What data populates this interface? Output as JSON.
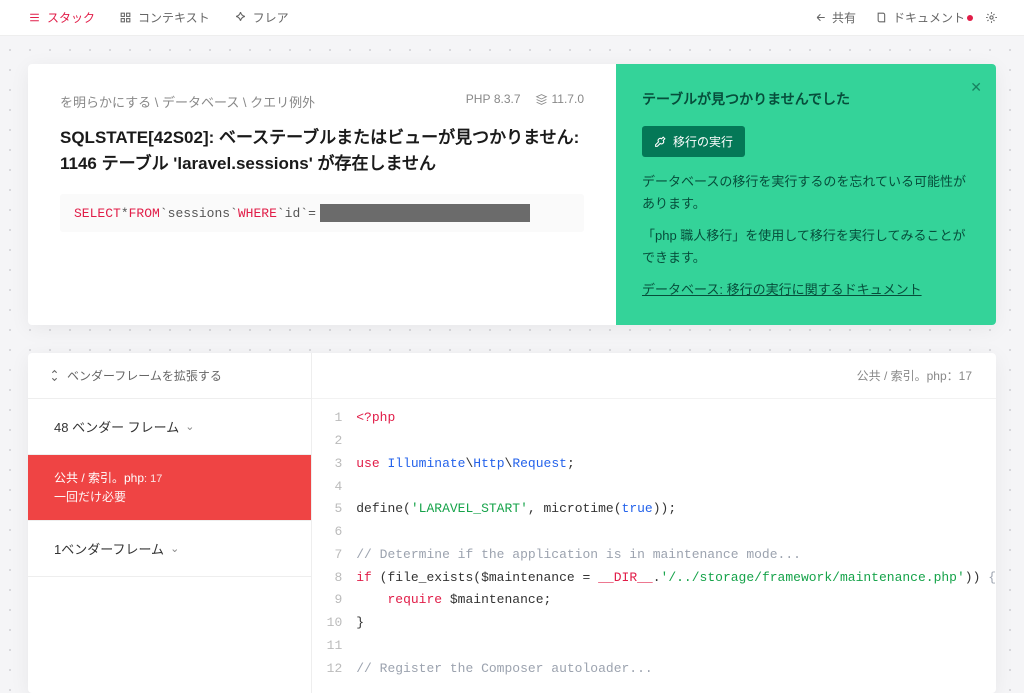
{
  "topbar": {
    "tabs": [
      {
        "label": "スタック",
        "active": true,
        "icon": "stack"
      },
      {
        "label": "コンテキスト",
        "active": false,
        "icon": "context"
      },
      {
        "label": "フレア",
        "active": false,
        "icon": "flare"
      }
    ],
    "share_label": "共有",
    "docs_label": "ドキュメント"
  },
  "error": {
    "breadcrumb": "を明らかにする \\ データベース \\ クエリ例外",
    "php_label": "PHP",
    "php_version": "8.3.7",
    "laravel_version": "11.7.0",
    "title": "SQLSTATE[42S02]: ベーステーブルまたはビューが見つかりません: 1146 テーブル 'laravel.sessions' が存在しません",
    "sql_tokens": {
      "select": "SELECT",
      "star": " * ",
      "from": "FROM",
      "table": " `sessions` ",
      "where": "WHERE",
      "col": " `id` ",
      "eq": "="
    }
  },
  "solution": {
    "title": "テーブルが見つかりませんでした",
    "run_button": "移行の実行",
    "line1": "データベースの移行を実行するのを忘れている可能性があります。",
    "line2": "「php 職人移行」を使用して移行を実行してみることができます。",
    "link": "データベース: 移行の実行に関するドキュメント"
  },
  "frames": {
    "expand_label": "ベンダーフレームを拡張する",
    "group1": "48 ベンダー フレーム",
    "active_path": "公共 / 索引。php",
    "active_line": ": 17",
    "active_desc": "一回だけ必要",
    "group2": "1ベンダーフレーム"
  },
  "codeheader": {
    "path": "公共 / 索引。php",
    "line": "：17"
  },
  "code_lines": [
    {
      "n": 1,
      "kind": "php_open"
    },
    {
      "n": 2,
      "kind": "blank"
    },
    {
      "n": 3,
      "kind": "use_request"
    },
    {
      "n": 4,
      "kind": "blank"
    },
    {
      "n": 5,
      "kind": "define_start"
    },
    {
      "n": 6,
      "kind": "blank"
    },
    {
      "n": 7,
      "kind": "comment",
      "text": "// Determine if the application is in maintenance mode..."
    },
    {
      "n": 8,
      "kind": "if_maint"
    },
    {
      "n": 9,
      "kind": "require_maint"
    },
    {
      "n": 10,
      "kind": "close_brace"
    },
    {
      "n": 11,
      "kind": "blank"
    },
    {
      "n": 12,
      "kind": "comment",
      "text": "// Register the Composer autoloader..."
    }
  ]
}
